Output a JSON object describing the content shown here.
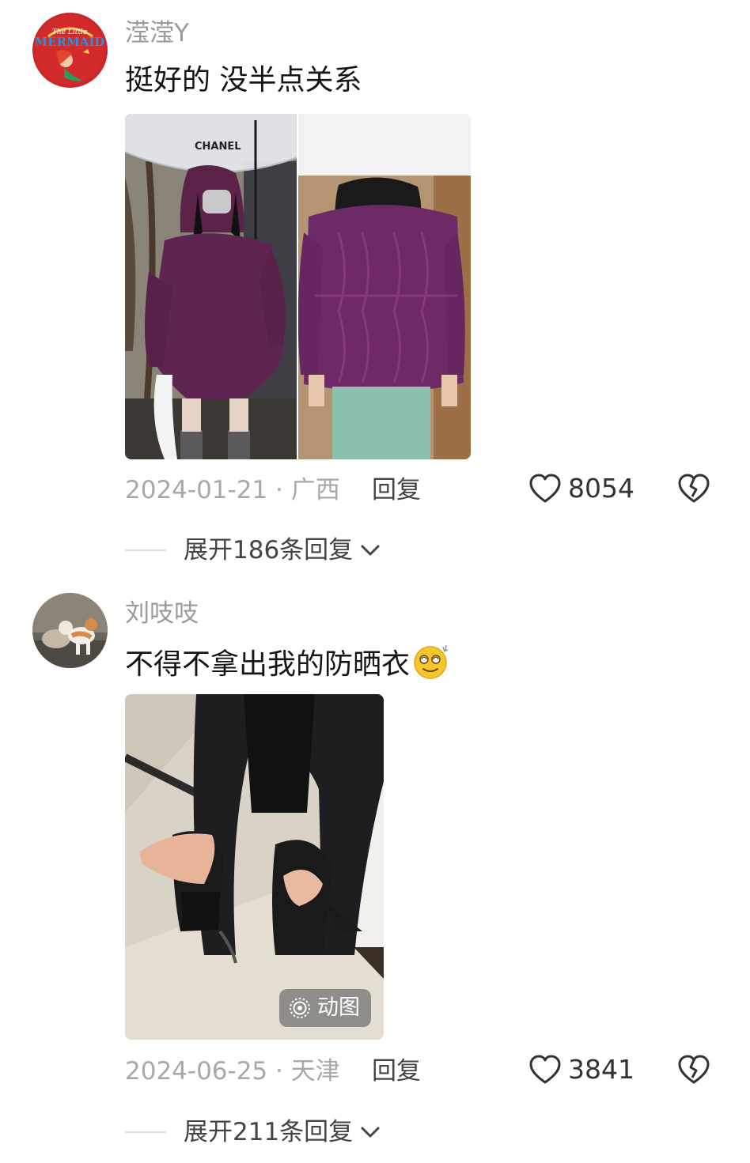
{
  "comments": [
    {
      "username": "滢滢Y",
      "text": "挺好的 没半点关系",
      "date": "2024-01-21",
      "location": "广西",
      "reply_label": "回复",
      "likes": "8054",
      "expand_label": "展开186条回复",
      "avatar_logo_text": "The Little Mermaid",
      "photo_brand_text": "CHANEL"
    },
    {
      "username": "刘吱吱",
      "text": "不得不拿出我的防晒衣",
      "date": "2024-06-25",
      "location": "天津",
      "reply_label": "回复",
      "likes": "3841",
      "expand_label": "展开211条回复",
      "gif_badge": "动图"
    }
  ],
  "meta_separator": " · ",
  "icons": {
    "like": "heart-outline-icon",
    "dislike": "broken-heart-icon",
    "expand": "chevron-down-icon",
    "gif": "live-photo-icon",
    "emoji": "dizzy-face-emoji"
  },
  "colors": {
    "username": "#9a9a9a",
    "text": "#151515",
    "meta": "#a8a8a8",
    "sweater": "#6e2a66"
  }
}
